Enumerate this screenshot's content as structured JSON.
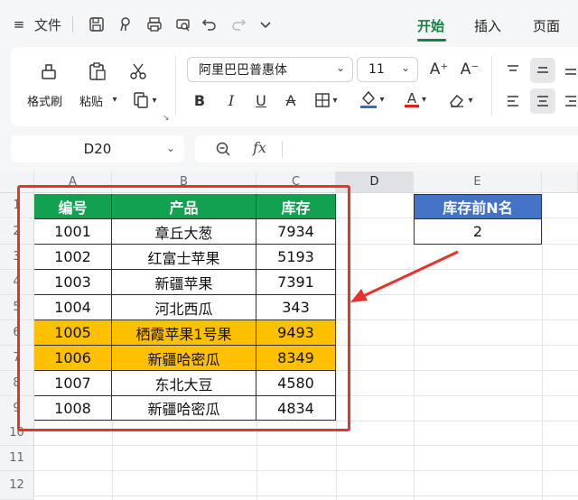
{
  "titlebar": {
    "menu_icon": "≡",
    "file_label": "文件",
    "tabs": [
      {
        "label": "开始",
        "active": true
      },
      {
        "label": "插入",
        "active": false
      },
      {
        "label": "页面",
        "active": false
      }
    ]
  },
  "ribbon": {
    "format_painter_label": "格式刷",
    "paste_label": "粘贴",
    "font_name": "阿里巴巴普惠体",
    "font_size": "11",
    "increase_font": "A⁺",
    "decrease_font": "A⁻",
    "bold": "B",
    "italic": "I",
    "underline": "U",
    "strike": "A",
    "font_color": "A"
  },
  "formula_bar": {
    "cell_ref": "D20",
    "fx_label": "fx",
    "content": ""
  },
  "sheet": {
    "columns": [
      "A",
      "B",
      "C",
      "D",
      "E"
    ],
    "rows": [
      "1",
      "2",
      "3",
      "4",
      "5",
      "6",
      "7",
      "8",
      "9",
      "10",
      "11",
      "12"
    ],
    "selected_column": "D",
    "table": {
      "headers": [
        "编号",
        "产品",
        "库存"
      ],
      "rows": [
        [
          "1001",
          "章丘大葱",
          "7934"
        ],
        [
          "1002",
          "红富士苹果",
          "5193"
        ],
        [
          "1003",
          "新疆苹果",
          "7391"
        ],
        [
          "1004",
          "河北西瓜",
          "343"
        ],
        [
          "1005",
          "栖霞苹果1号果",
          "9493"
        ],
        [
          "1006",
          "新疆哈密瓜",
          "8349"
        ],
        [
          "1007",
          "东北大豆",
          "4580"
        ],
        [
          "1008",
          "新疆哈密瓜",
          "4834"
        ]
      ],
      "highlighted_rows": [
        4,
        5
      ]
    },
    "param": {
      "header": "库存前N名",
      "value": "2"
    }
  },
  "colors": {
    "header_green": "#12a150",
    "highlight_yellow": "#ffc000",
    "param_header_blue": "#4472c4",
    "annotation_red": "#e8332d",
    "active_tab_green": "#1a7f45"
  }
}
